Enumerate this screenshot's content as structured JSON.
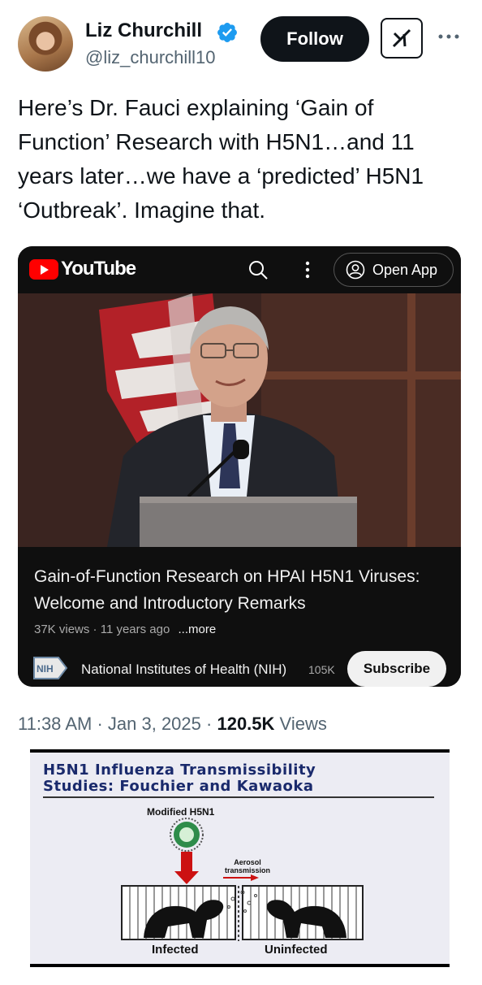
{
  "author": {
    "name": "Liz Churchill",
    "handle": "@liz_churchill10"
  },
  "actions": {
    "follow_label": "Follow"
  },
  "tweet": {
    "text": "Here’s Dr. Fauci explaining ‘Gain of Function’ Research with H5N1…and 11 years later…we have a ‘predicted’ H5N1 ‘Outbreak’. Imagine that."
  },
  "youtube": {
    "brand": "YouTube",
    "open_app_label": "Open App",
    "video_title": "Gain-of-Function Research on HPAI H5N1 Viruses: Welcome and Introductory Remarks",
    "views": "37K views",
    "age": "11 years ago",
    "more_label": "...more",
    "channel_logo_text": "NIH",
    "channel_name": "National Institutes of Health (NIH)",
    "subscriber_count": "105K",
    "subscribe_label": "Subscribe"
  },
  "meta": {
    "time": "11:38 AM",
    "date": "Jan 3, 2025",
    "views_count": "120.5K",
    "views_label": "Views"
  },
  "slide": {
    "title_line1": "H5N1 Influenza Transmissibility",
    "title_line2": "Studies: Fouchier and Kawaoka",
    "modified_label": "Modified H5N1",
    "aerosol_line1": "Aerosol",
    "aerosol_line2": "transmission",
    "infected_label": "Infected",
    "uninfected_label": "Uninfected"
  },
  "colors": {
    "accent_verified": "#1d9bf0",
    "youtube_red": "#ff0000",
    "slide_title_blue": "#1a2a6c"
  }
}
